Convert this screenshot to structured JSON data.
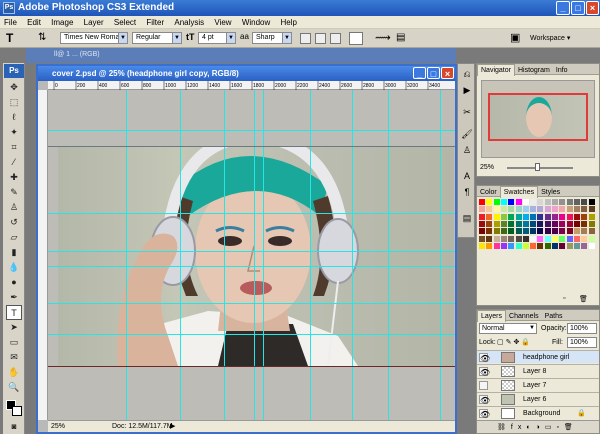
{
  "app": {
    "title": "Adobe Photoshop CS3 Extended",
    "logo": "Ps"
  },
  "menu": [
    "File",
    "Edit",
    "Image",
    "Layer",
    "Select",
    "Filter",
    "Analysis",
    "View",
    "Window",
    "Help"
  ],
  "options": {
    "font_family": "Times New Roman",
    "font_style": "Regular",
    "font_size": "4 pt",
    "antialias": "Sharp",
    "workspace": "Workspace ▾"
  },
  "document": {
    "background_title": "ll@ 1 ... (RGB)",
    "title": "cover 2.psd @ 25% (headphone girl copy, RGB/8)",
    "ruler_marks": [
      "0",
      "200",
      "400",
      "600",
      "800",
      "1000",
      "1200",
      "1400",
      "1600",
      "1800",
      "2000",
      "2200",
      "2400",
      "2600",
      "2800",
      "3000",
      "3200",
      "3400"
    ],
    "zoom": "25%",
    "doc_size": "Doc: 12.5M/117.7M"
  },
  "navigator": {
    "tabs": [
      "Navigator",
      "Histogram",
      "Info"
    ],
    "zoom": "25%"
  },
  "swatches": {
    "tabs": [
      "Color",
      "Swatches",
      "Styles"
    ]
  },
  "layers": {
    "tabs": [
      "Layers",
      "Channels",
      "Paths"
    ],
    "blend_mode": "Normal",
    "opacity_label": "Opacity:",
    "opacity": "100%",
    "lock_label": "Lock:",
    "fill_label": "Fill:",
    "fill": "100%",
    "items": [
      {
        "name": "headphone girl",
        "visible": true
      },
      {
        "name": "Layer 8",
        "visible": true
      },
      {
        "name": "Layer 7",
        "visible": false
      },
      {
        "name": "Layer 6",
        "visible": true
      },
      {
        "name": "Background",
        "visible": true
      }
    ]
  },
  "colors": {
    "title_blue": "#2a60c4",
    "guide": "#25e5e5",
    "hair": "#1aa89a"
  }
}
